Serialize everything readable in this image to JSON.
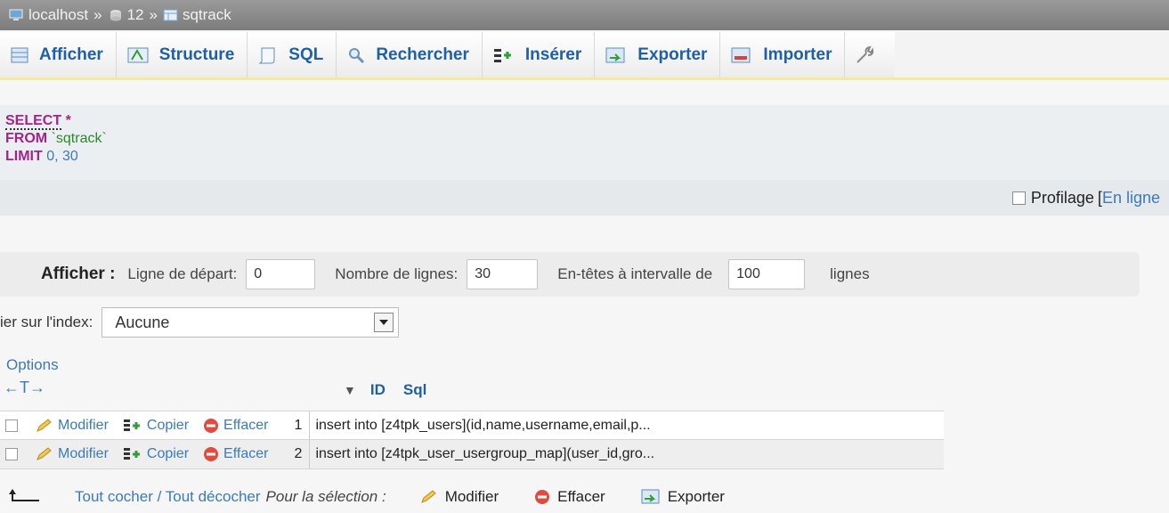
{
  "breadcrumb": {
    "server": "localhost",
    "database": "12",
    "table": "sqtrack",
    "separator": "»"
  },
  "tabs": [
    {
      "label": "Afficher",
      "icon": "browse-icon"
    },
    {
      "label": "Structure",
      "icon": "structure-icon"
    },
    {
      "label": "SQL",
      "icon": "sql-icon"
    },
    {
      "label": "Rechercher",
      "icon": "search-icon"
    },
    {
      "label": "Insérer",
      "icon": "insert-icon"
    },
    {
      "label": "Exporter",
      "icon": "export-icon"
    },
    {
      "label": "Importer",
      "icon": "import-icon"
    }
  ],
  "sql": {
    "kw_select": "SELECT",
    "star": "*",
    "kw_from": "FROM",
    "table": "`sqtrack`",
    "kw_limit": "LIMIT",
    "limit_start": "0",
    "limit_sep": ",",
    "limit_count": "30"
  },
  "profiling": {
    "label": "Profilage",
    "bracket": "[",
    "link": "En ligne"
  },
  "navigation": {
    "label": "Afficher :",
    "start_label": "Ligne de départ:",
    "start_value": "0",
    "rows_label": "Nombre de lignes:",
    "rows_value": "30",
    "headers_label": "En-têtes à intervalle de",
    "headers_value": "100",
    "lines_label": "lignes"
  },
  "sort": {
    "label": "ier sur l'index:",
    "selected": "Aucune"
  },
  "options_label": "Options",
  "arrows": "←T→",
  "columns": {
    "id": "ID",
    "sql": "Sql"
  },
  "rows": [
    {
      "edit": "Modifier",
      "copy": "Copier",
      "delete": "Effacer",
      "id": "1",
      "sql": "insert into [z4tpk_users](id,name,username,email,p..."
    },
    {
      "edit": "Modifier",
      "copy": "Copier",
      "delete": "Effacer",
      "id": "2",
      "sql": "insert into [z4tpk_user_usergroup_map](user_id,gro..."
    }
  ],
  "bottom": {
    "check_all": "Tout cocher / Tout décocher",
    "for_selection": "Pour la sélection :",
    "edit": "Modifier",
    "delete": "Effacer",
    "export": "Exporter"
  }
}
